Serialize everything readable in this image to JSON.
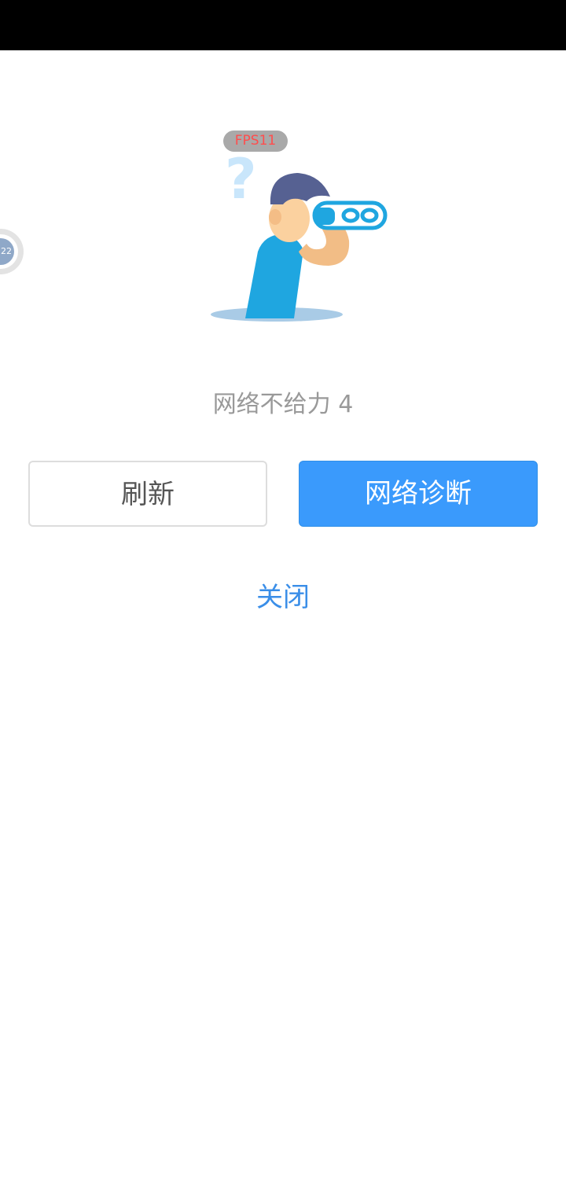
{
  "overlay": {
    "fps_label": "FPS11",
    "float_ball_label": "22"
  },
  "error": {
    "message": "网络不给力 4"
  },
  "actions": {
    "refresh_label": "刷新",
    "diagnose_label": "网络诊断",
    "close_label": "关闭"
  },
  "colors": {
    "primary": "#3a9afc",
    "link": "#3a8ee8",
    "message_text": "#999999"
  },
  "icons": {
    "illustration": "person-with-binoculars-icon"
  }
}
